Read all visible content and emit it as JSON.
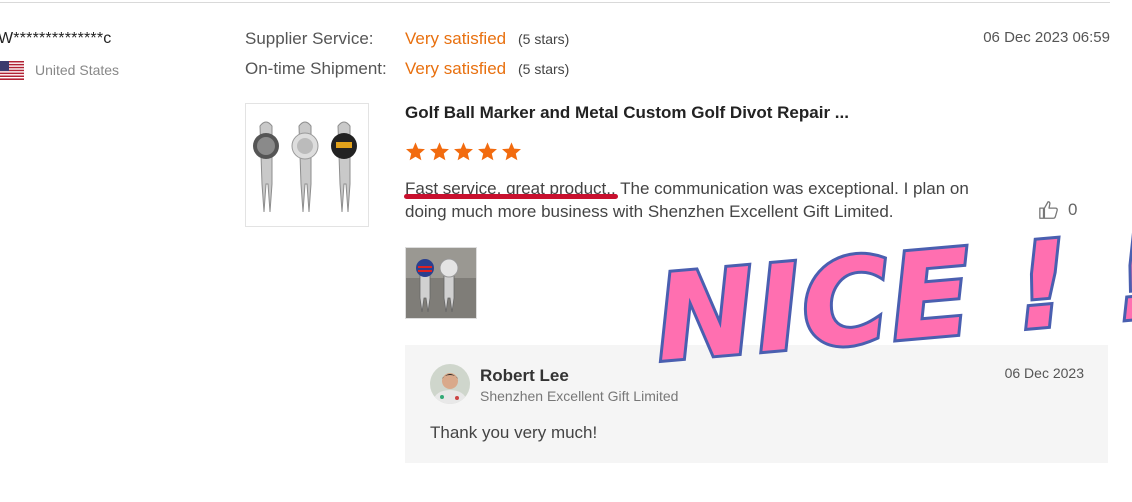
{
  "reviewer": {
    "name": "W**************c",
    "country": "United States",
    "flag_icon": "us-flag-icon"
  },
  "ratings": [
    {
      "label": "Supplier Service:",
      "value": "Very satisfied",
      "stars_text": "(5 stars)"
    },
    {
      "label": "On-time Shipment:",
      "value": "Very satisfied",
      "stars_text": "(5 stars)"
    }
  ],
  "review_date": "06 Dec 2023 06:59",
  "product": {
    "title": "Golf Ball Marker and Metal Custom Golf Divot Repair ...",
    "rating": 5
  },
  "review": {
    "text": "Fast service, great product., The communication was exceptional. I plan on doing much more business with Shenzhen Excellent Gift Limited.",
    "likes": "0"
  },
  "reply": {
    "name": "Robert Lee",
    "company": "Shenzhen Excellent Gift Limited",
    "date": "06 Dec 2023",
    "text": "Thank you very much!"
  },
  "sticker": {
    "text": "NICE ! !",
    "color": "#ff6fb0"
  },
  "colors": {
    "accent": "#e8700f",
    "underline": "#c8102e",
    "reply_bg": "#f5f5f5"
  }
}
